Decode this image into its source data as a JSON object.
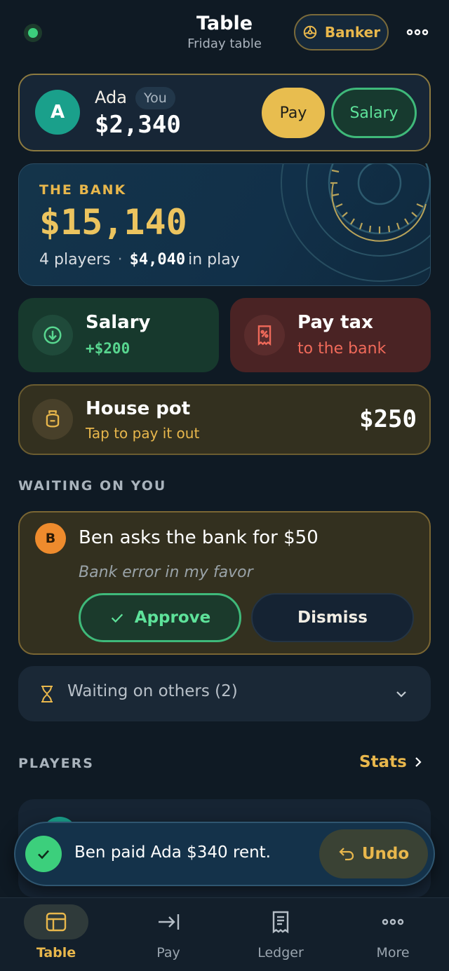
{
  "colors": {
    "accent_gold": "#e8b74c",
    "success_green": "#3ccf7c",
    "danger_red": "#f06a5a",
    "background": "#0f1a24"
  },
  "header": {
    "title": "Table",
    "subtitle": "Friday table",
    "banker_label": "Banker",
    "status_icon": "online-dot-icon",
    "more_icon": "more-horizontal-icon"
  },
  "me": {
    "initial": "A",
    "name": "Ada",
    "you_badge": "You",
    "balance": "$2,340",
    "pay_label": "Pay",
    "salary_label": "Salary"
  },
  "bank": {
    "label": "THE BANK",
    "amount": "$15,140",
    "players_text": "4 players",
    "separator": "·",
    "in_play_amount": "$4,040",
    "in_play_suffix": "in play"
  },
  "actions": {
    "salary": {
      "title": "Salary",
      "subtitle": "+$200",
      "icon": "arrow-down-circle-icon"
    },
    "tax": {
      "title": "Pay tax",
      "subtitle": "to the bank",
      "icon": "receipt-percent-icon"
    }
  },
  "house_pot": {
    "title": "House pot",
    "subtitle": "Tap to pay it out",
    "amount": "$250",
    "icon": "pot-icon"
  },
  "waiting": {
    "heading": "WAITING ON YOU",
    "request": {
      "initial": "B",
      "title": "Ben asks the bank for $50",
      "note": "Bank error in my favor",
      "approve_label": "Approve",
      "dismiss_label": "Dismiss"
    },
    "others_label": "Waiting on others (2)"
  },
  "players": {
    "heading": "PLAYERS",
    "stats_label": "Stats"
  },
  "toast": {
    "message": "Ben paid Ada $340 rent.",
    "undo_label": "Undo"
  },
  "nav": {
    "items": [
      {
        "label": "Table",
        "icon": "layout-icon",
        "active": true
      },
      {
        "label": "Pay",
        "icon": "arrow-to-line-icon",
        "active": false
      },
      {
        "label": "Ledger",
        "icon": "receipt-icon",
        "active": false
      },
      {
        "label": "More",
        "icon": "more-horizontal-icon",
        "active": false
      }
    ]
  }
}
